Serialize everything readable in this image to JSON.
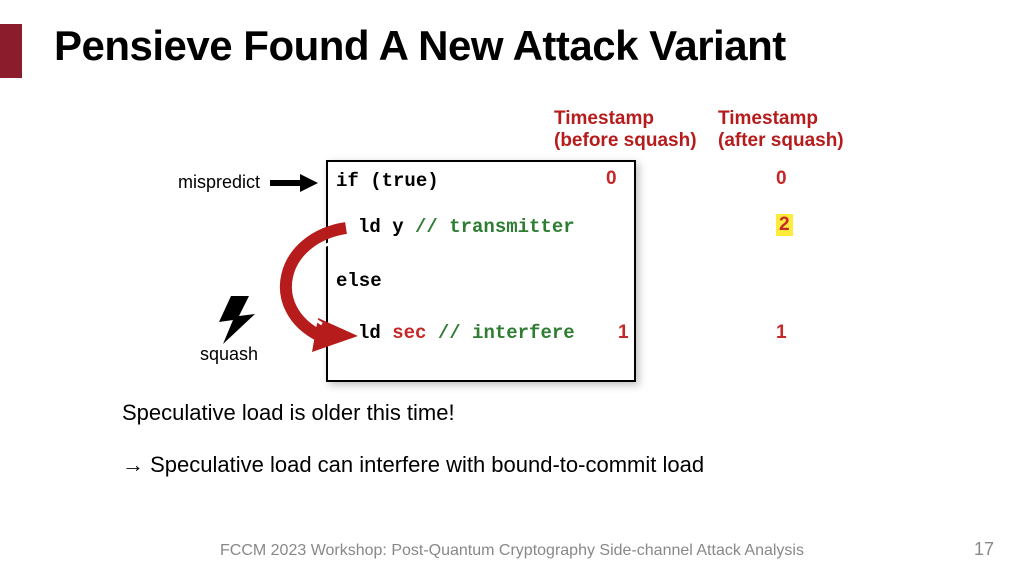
{
  "title": "Pensieve Found A New Attack Variant",
  "columns": {
    "before": "Timestamp\n(before squash)",
    "after": "Timestamp\n(after squash)"
  },
  "labels": {
    "mispredict": "mispredict",
    "squash": "squash"
  },
  "code": {
    "l1": "if (true)",
    "l2_a": "ld y ",
    "l2_b": "// transmitter",
    "l3": "else",
    "l4_a": "ld ",
    "l4_sec": "sec",
    "l4_b": " // interfere"
  },
  "timestamps": {
    "before_if": "0",
    "before_ldsec": "1",
    "after_if": "0",
    "after_ldy": "2",
    "after_ldsec": "1"
  },
  "body": {
    "line1": "Speculative load is older this time!",
    "line2": "→ Speculative load can interfere with bound-to-commit load"
  },
  "footer": "FCCM 2023 Workshop: Post-Quantum Cryptography Side-channel Attack Analysis",
  "page": "17"
}
